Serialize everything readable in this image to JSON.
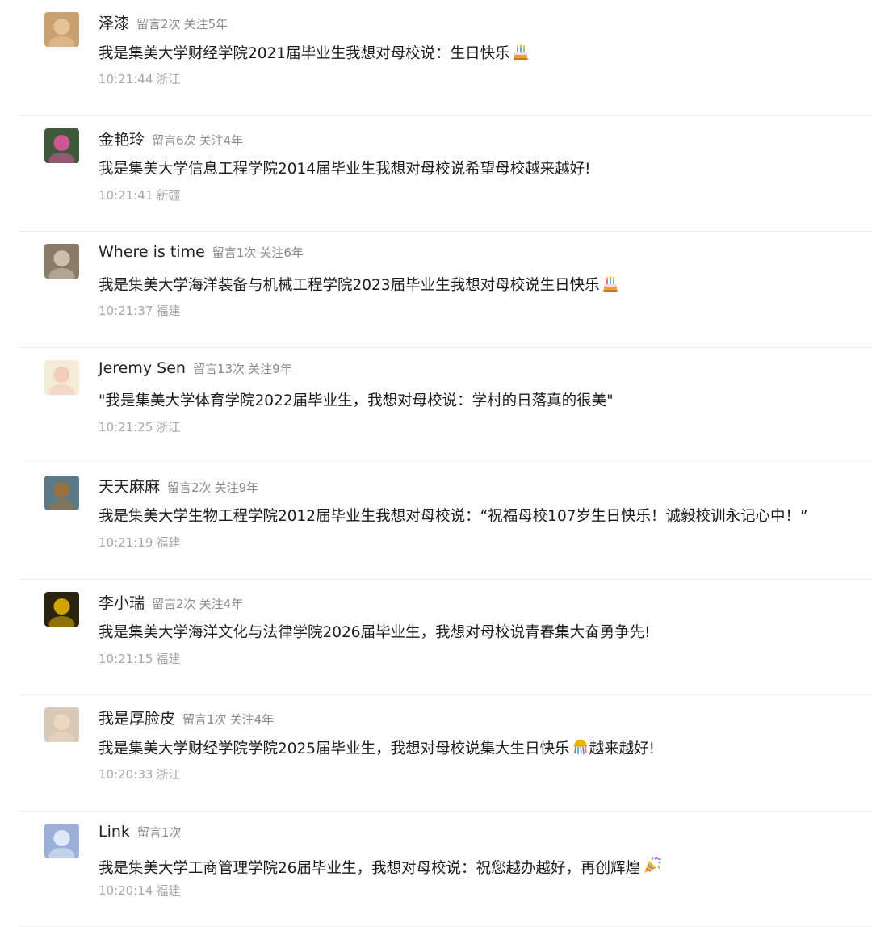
{
  "comments": [
    {
      "nickname": "泽漆",
      "count": "留言2次",
      "follow": "关注5年",
      "text": "我是集美大学财经学院2021届毕业生我想对母校说：生日快乐",
      "emoji": "cake-emoji",
      "time": "10:21:44",
      "location": "浙江",
      "avatar_colors": [
        "#c9a070",
        "#e8c69a"
      ]
    },
    {
      "nickname": "金艳玲",
      "count": "留言6次",
      "follow": "关注4年",
      "text": "我是集美大学信息工程学院2014届毕业生我想对母校说希望母校越来越好!",
      "time": "10:21:41",
      "location": "新疆",
      "avatar_colors": [
        "#3e5a3a",
        "#d8569a"
      ]
    },
    {
      "nickname": "Where is time",
      "count": "留言1次",
      "follow": "关注6年",
      "text": "我是集美大学海洋装备与机械工程学院2023届毕业生我想对母校说生日快乐",
      "emoji": "cake-emoji",
      "time": "10:21:37",
      "location": "福建",
      "avatar_colors": [
        "#8a7a66",
        "#d2c6b4"
      ]
    },
    {
      "nickname": "Jeremy Sen",
      "count": "留言13次",
      "follow": "关注9年",
      "text": "\"我是集美大学体育学院2022届毕业生，我想对母校说：学村的日落真的很美\"",
      "time": "10:21:25",
      "location": "浙江",
      "avatar_colors": [
        "#f5ecd8",
        "#f2c9b8"
      ]
    },
    {
      "nickname": "天天麻麻",
      "count": "留言2次",
      "follow": "关注9年",
      "text": "我是集美大学生物工程学院2012届毕业生我想对母校说：“祝福母校107岁生日快乐！诚毅校训永记心中！”",
      "time": "10:21:19",
      "location": "福建",
      "avatar_colors": [
        "#5a7a8a",
        "#a0703a"
      ]
    },
    {
      "nickname": "李小瑞",
      "count": "留言2次",
      "follow": "关注4年",
      "text": "我是集美大学海洋文化与法律学院2026届毕业生，我想对母校说青春集大奋勇争先!",
      "time": "10:21:15",
      "location": "福建",
      "avatar_colors": [
        "#2a2410",
        "#e0b000"
      ]
    },
    {
      "nickname": "我是厚脸皮",
      "count": "留言1次",
      "follow": "关注4年",
      "text": "我是集美大学财经学院学院2025届毕业生，我想对母校说集大生日快乐",
      "emoji": "confetti-ball-emoji",
      "text_after": "越来越好!",
      "time": "10:20:33",
      "location": "浙江",
      "avatar_colors": [
        "#d8c8b8",
        "#f0d8c0"
      ]
    },
    {
      "nickname": "Link",
      "count": "留言1次",
      "text": "我是集美大学工商管理学院26届毕业生，我想对母校说：祝您越办越好，再创辉煌",
      "emoji": "party-popper-emoji",
      "time": "10:20:14",
      "location": "福建",
      "avatar_colors": [
        "#9ab0d8",
        "#e8eef8"
      ]
    }
  ]
}
